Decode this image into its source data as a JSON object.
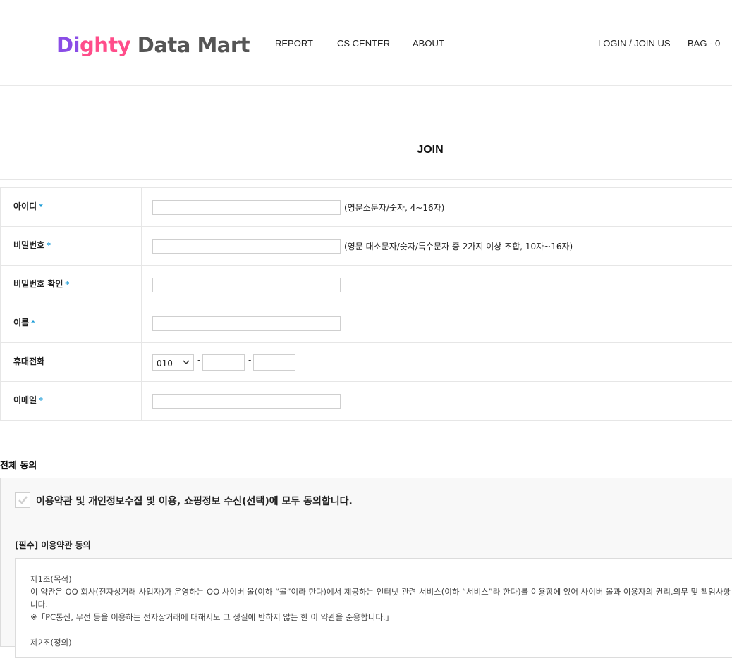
{
  "header": {
    "logo": {
      "part1": "Di",
      "part2": "ghty",
      "part3": " Data Mart"
    },
    "nav": [
      "REPORT",
      "CS CENTER",
      "ABOUT"
    ],
    "login": "LOGIN / JOIN US",
    "bag": "BAG - 0"
  },
  "page_title": "JOIN",
  "form": {
    "required_mark": "*",
    "rows": [
      {
        "label": "아이디",
        "hint": "(영문소문자/숫자, 4~16자)"
      },
      {
        "label": "비밀번호",
        "hint": "(영문 대소문자/숫자/특수문자 중 2가지 이상 조합, 10자~16자)"
      },
      {
        "label": "비밀번호 확인"
      },
      {
        "label": "이름"
      },
      {
        "label": "휴대전화",
        "phone_prefix": "010",
        "dash": "-"
      },
      {
        "label": "이메일"
      }
    ]
  },
  "agreement": {
    "section_title": "전체 동의",
    "agree_all": "이용약관 및 개인정보수집 및 이용, 쇼핑정보 수신(선택)에 모두 동의합니다.",
    "terms_label": "[필수] 이용약관 동의",
    "terms_lines": [
      "제1조(목적)",
      "이 약관은 OO 회사(전자상거래 사업자)가 운영하는 OO 사이버 몰(이하 “몰”이라 한다)에서 제공하는 인터넷 관련 서비스(이하 “서비스”라 한다)를 이용함에 있어 사이버 몰과 이용자의 권리.의무 및 책임사항",
      "니다.",
      "※「PC통신, 무선 등을 이용하는 전자상거래에 대해서도 그 성질에 반하지 않는 한 이 약관을 준용합니다.」",
      "",
      "제2조(정의)"
    ]
  }
}
